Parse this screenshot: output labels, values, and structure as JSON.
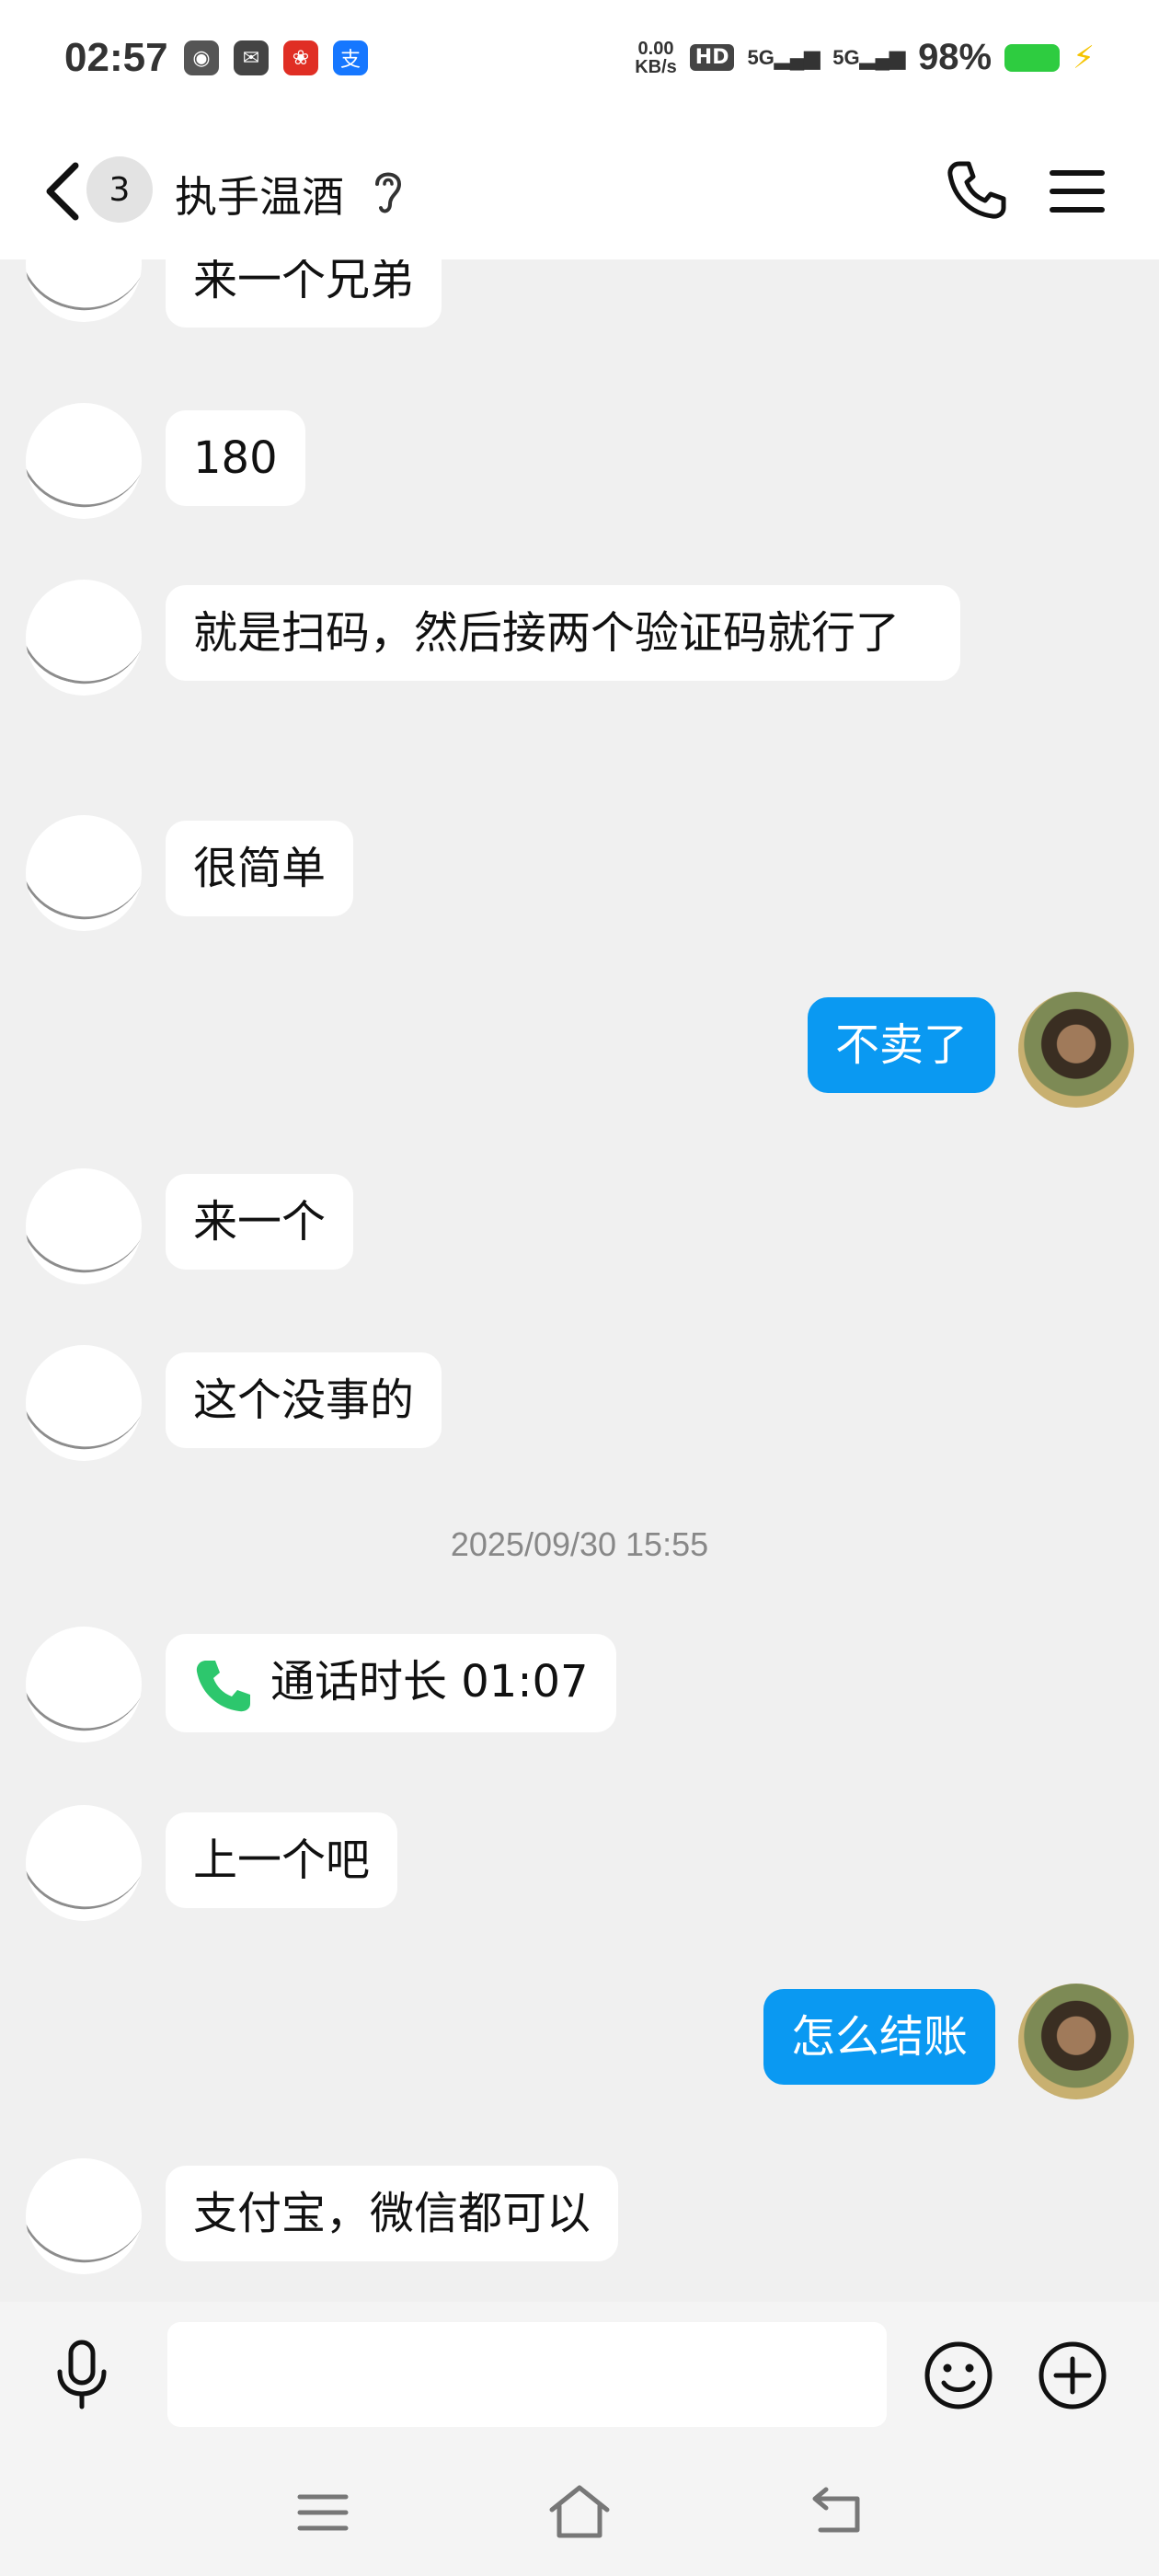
{
  "status_bar": {
    "time": "02:57",
    "net_speed_value": "0.00",
    "net_speed_unit": "KB/s",
    "hd": "HD",
    "signal1": "5G",
    "signal2": "5G",
    "battery": "98%",
    "battery_color": "#2ecc40",
    "left_icons": [
      "app-icon-1",
      "mail-icon",
      "pinduoduo-icon",
      "alipay-icon"
    ]
  },
  "header": {
    "unread_count": "3",
    "title": "执手温酒"
  },
  "messages": [
    {
      "side": "in",
      "text": "来一个兄弟"
    },
    {
      "side": "in",
      "text": "180"
    },
    {
      "side": "in",
      "text": "就是扫码，然后接两个验证码就行了"
    },
    {
      "side": "in",
      "text": "很简单"
    },
    {
      "side": "out",
      "text": "不卖了"
    },
    {
      "side": "in",
      "text": "来一个"
    },
    {
      "side": "in",
      "text": "这个没事的"
    },
    {
      "side": "time",
      "text": "2025/09/30 15:55"
    },
    {
      "side": "in",
      "type": "call",
      "text": "通话时长 01:07"
    },
    {
      "side": "in",
      "text": "上一个吧"
    },
    {
      "side": "out",
      "text": "怎么结账"
    },
    {
      "side": "in",
      "text": "支付宝，微信都可以"
    }
  ],
  "input": {
    "placeholder": ""
  },
  "colors": {
    "out_bubble": "#0a99f2",
    "in_bubble": "#ffffff",
    "background": "#f0f0f0"
  }
}
